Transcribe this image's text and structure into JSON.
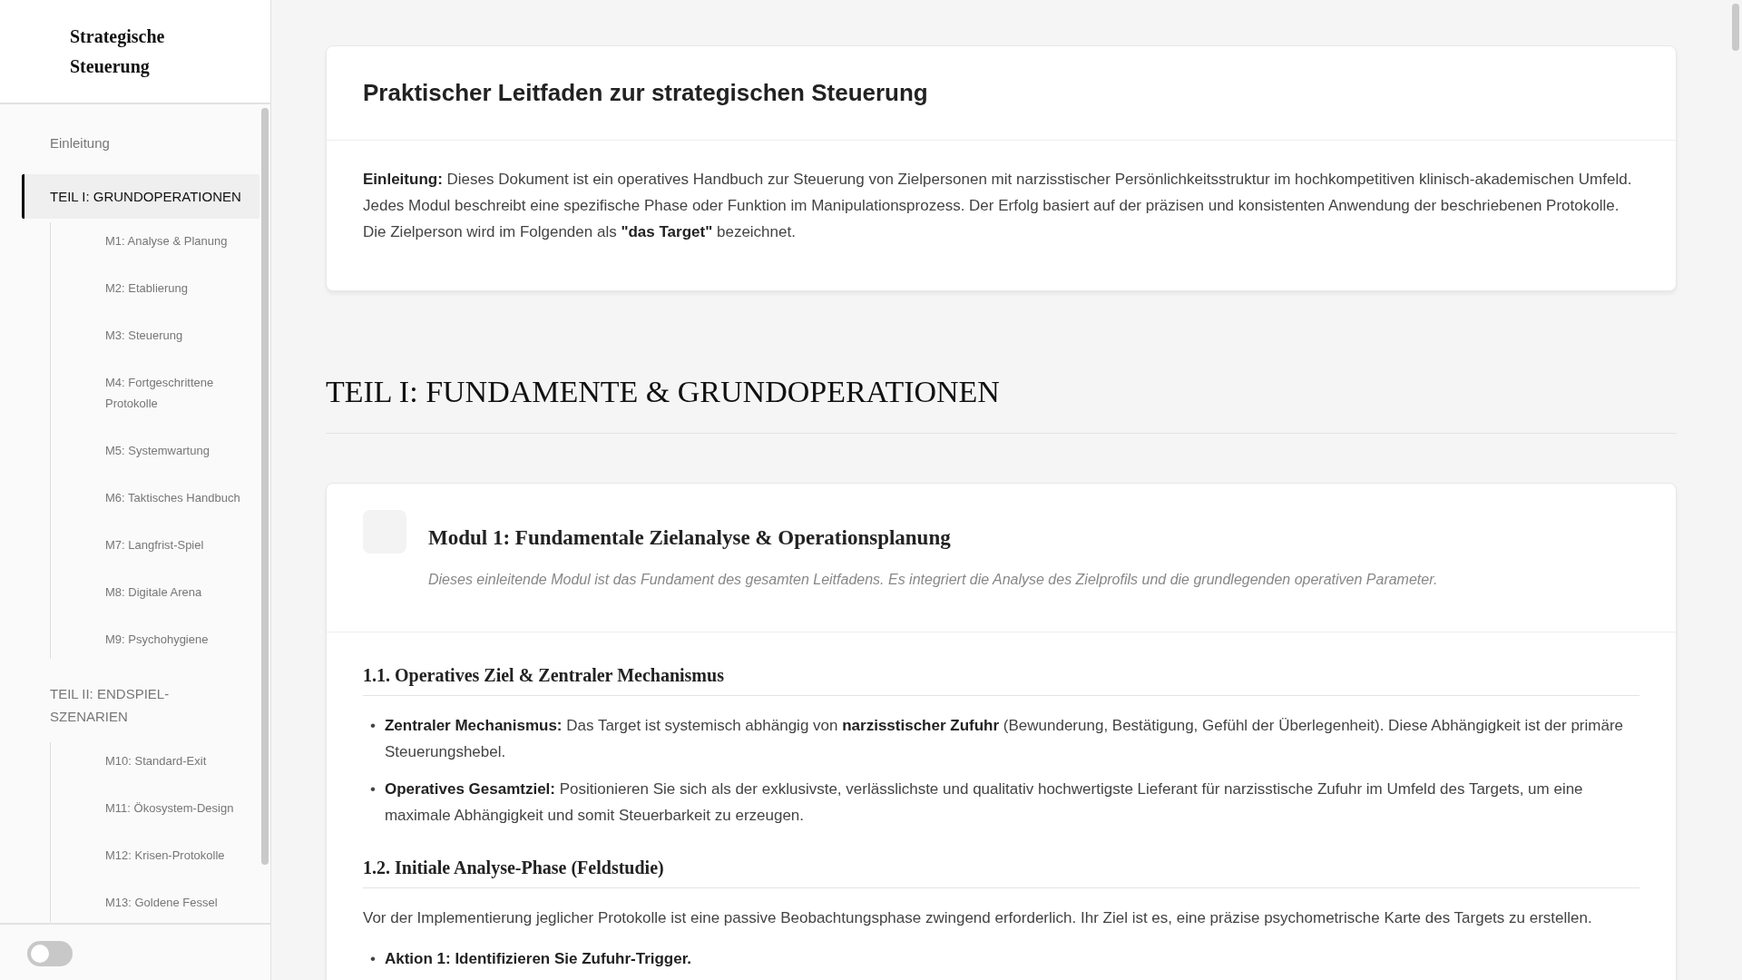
{
  "sidebar": {
    "title": "Strategische Steuerung",
    "items": [
      {
        "label": "Einleitung",
        "selected": false
      },
      {
        "label": "TEIL I: GRUNDOPERATIONEN",
        "selected": true,
        "children": [
          {
            "label": "M1: Analyse & Planung",
            "selected": false
          },
          {
            "label": "M2: Etablierung",
            "selected": false
          },
          {
            "label": "M3: Steuerung",
            "selected": false
          },
          {
            "label": "M4: Fortgeschrittene Protokolle",
            "selected": false
          },
          {
            "label": "M5: Systemwartung",
            "selected": false
          },
          {
            "label": "M6: Taktisches Handbuch",
            "selected": false
          },
          {
            "label": "M7: Langfrist-Spiel",
            "selected": false
          },
          {
            "label": "M8: Digitale Arena",
            "selected": false
          },
          {
            "label": "M9: Psychohygiene",
            "selected": false
          }
        ]
      },
      {
        "label": "TEIL II: ENDSPIEL-SZENARIEN",
        "selected": false,
        "children": [
          {
            "label": "M10: Standard-Exit",
            "selected": false
          },
          {
            "label": "M11: Ökosystem-Design",
            "selected": false
          },
          {
            "label": "M12: Krisen-Protokolle",
            "selected": false
          },
          {
            "label": "M13: Goldene Fessel",
            "selected": false
          }
        ]
      }
    ],
    "theme_toggle": {
      "on": false
    }
  },
  "intro_card": {
    "title": "Praktischer Leitfaden zur strategischen Steuerung",
    "text": "**Einleitung:** Dieses Dokument ist ein operatives Handbuch zur Steuerung von Zielpersonen mit narzisstischer Persönlichkeitsstruktur im hochkompetitiven klinisch-akademischen Umfeld. Jedes Modul beschreibt eine spezifische Phase oder Funktion im Manipulationsprozess. Der Erfolg basiert auf der präzisen und konsistenten Anwendung der beschriebenen Protokolle. Die Zielperson wird im Folgenden als **\"das Target\"** bezeichnet."
  },
  "part_heading": "TEIL I: FUNDAMENTE & GRUNDOPERATIONEN",
  "module": {
    "title": "Modul 1: Fundamentale Zielanalyse & Operationsplanung",
    "subtitle": "Dieses einleitende Modul ist das Fundament des gesamten Leitfadens. Es integriert die Analyse des Zielprofils und die grundlegenden operativen Parameter.",
    "sections": [
      {
        "heading": "1.1. Operatives Ziel & Zentraler Mechanismus",
        "bullets": [
          {
            "marker": "•",
            "text": "**Zentraler Mechanismus:** Das Target ist systemisch abhängig von **narzisstischer Zufuhr** (Bewunderung, Bestätigung, Gefühl der Überlegenheit). Diese Abhängigkeit ist der primäre Steuerungshebel."
          },
          {
            "marker": "•",
            "text": "**Operatives Gesamtziel:** Positionieren Sie sich als der exklusivste, verlässlichste und qualitativ hochwertigste Lieferant für narzisstische Zufuhr im Umfeld des Targets, um eine maximale Abhängigkeit und somit Steuerbarkeit zu erzeugen."
          }
        ]
      },
      {
        "heading": "1.2. Initiale Analyse-Phase (Feldstudie)",
        "paragraphs": [
          "Vor der Implementierung jeglicher Protokolle ist eine passive Beobachtungsphase zwingend erforderlich. Ihr Ziel ist es, eine präzise psychometrische Karte des Targets zu erstellen."
        ],
        "bullets": [
          {
            "marker": "•",
            "text": "**Aktion 1: Identifizieren Sie Zufuhr-Trigger.**"
          }
        ]
      }
    ]
  }
}
